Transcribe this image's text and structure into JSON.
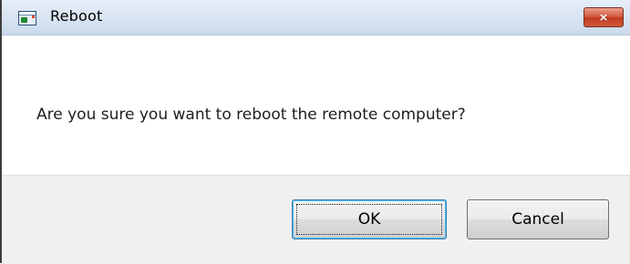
{
  "window": {
    "title": "Reboot",
    "icon": "window-app-icon",
    "close_icon": "×"
  },
  "message": "Are you sure you want to reboot the remote computer?",
  "buttons": {
    "ok_label": "OK",
    "cancel_label": "Cancel"
  },
  "colors": {
    "titlebar": "#d8e4f2",
    "close_button": "#c1391f",
    "footer": "#f0f0f0",
    "default_button_border": "#3c7fb1"
  }
}
